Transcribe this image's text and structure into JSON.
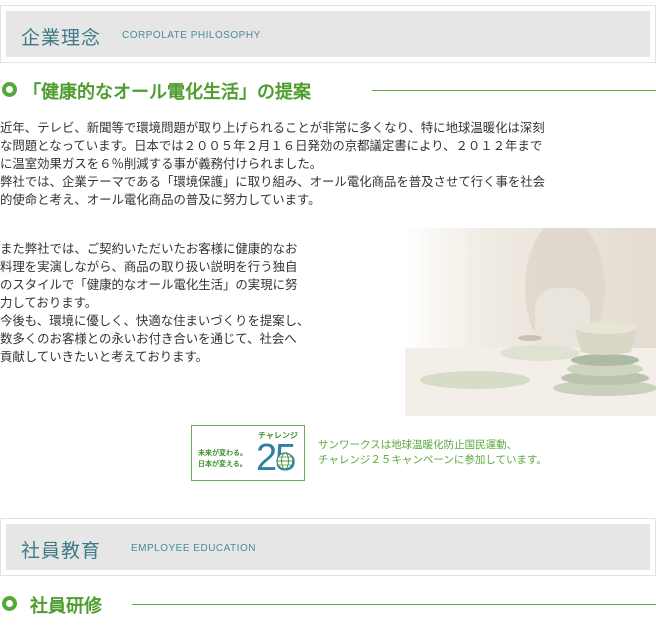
{
  "philosophy_section": {
    "title_jp": "企業理念",
    "title_en": "CORPOLATE  PHILOSOPHY"
  },
  "proposal": {
    "heading": "「健康的なオール電化生活」の提案",
    "paragraph1": [
      "近年、テレビ、新聞等で環境問題が取り上げられることが非常に多くなり、特に地球温暖化は深刻",
      "な問題となっています。日本では２００５年２月１６日発効の京都議定書により、２０１２年まで",
      "に温室効果ガスを６％削減する事が義務付けられました。",
      "弊社では、企業テーマである「環境保護」に取り組み、オール電化商品を普及させて行く事を社会",
      "的使命と考え、オール電化商品の普及に努力しています。"
    ],
    "paragraph2": [
      "また弊社では、ご契約いただいたお客様に健康的なお",
      "料理を実演しながら、商品の取り扱い説明を行う独自",
      "のスタイルで「健康的なオール電化生活」の実現に努",
      "力しております。",
      "今後も、環境に優しく、快適な住まいづくりを提案し、",
      "数多くのお客様との永いお付き合いを通じて、社会へ",
      "貢献していきたいと考えております。"
    ]
  },
  "challenge_badge": {
    "top_label": "チャレンジ",
    "line1": "未来が変わる。",
    "line2": "日本が変える。",
    "number": "25",
    "note_line1": "サンワークスは地球温暖化防止国民運動、",
    "note_line2": "チャレンジ２５キャンペーンに参加しています。"
  },
  "education_section": {
    "title_jp": "社員教育",
    "title_en": "EMPLOYEE EDUCATION"
  },
  "training": {
    "heading": "社員研修"
  },
  "colors": {
    "accent_green": "#4d9d2f",
    "header_teal": "#3d7a87",
    "header_bg": "#e6e6e6"
  }
}
